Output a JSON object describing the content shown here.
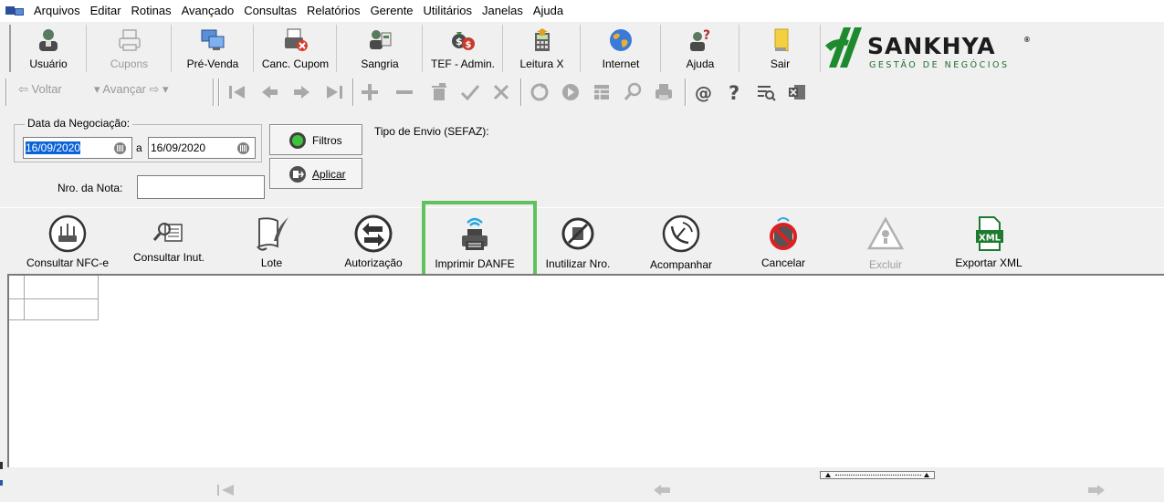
{
  "menubar": {
    "items": [
      "Arquivos",
      "Editar",
      "Rotinas",
      "Avançado",
      "Consultas",
      "Relatórios",
      "Gerente",
      "Utilitários",
      "Janelas",
      "Ajuda"
    ]
  },
  "toolbar": {
    "buttons": [
      {
        "label": "Usuário",
        "icon": "user-icon",
        "enabled": true
      },
      {
        "label": "Cupons",
        "icon": "printer-icon",
        "enabled": false
      },
      {
        "label": "Pré-Venda",
        "icon": "monitors-icon",
        "enabled": true
      },
      {
        "label": "Canc. Cupom",
        "icon": "cancel-receipt-icon",
        "enabled": true
      },
      {
        "label": "Sangria",
        "icon": "cashier-icon",
        "enabled": true
      },
      {
        "label": "TEF - Admin.",
        "icon": "money-bag-icon",
        "enabled": true
      },
      {
        "label": "Leitura X",
        "icon": "calculator-icon",
        "enabled": true
      },
      {
        "label": "Internet",
        "icon": "globe-icon",
        "enabled": true
      },
      {
        "label": "Ajuda",
        "icon": "help-user-icon",
        "enabled": true
      },
      {
        "label": "Sair",
        "icon": "exit-door-icon",
        "enabled": true
      }
    ]
  },
  "navbar": {
    "back_label": "Voltar",
    "forward_label": "Avançar"
  },
  "logo": {
    "name": "SANKHYA",
    "tagline": "GESTÃO DE NEGÓCIOS",
    "reg": "®"
  },
  "filter": {
    "date_label": "Data da Negociação:",
    "date_from": "16/09/2020",
    "date_sep": "a",
    "date_to": "16/09/2020",
    "nota_label": "Nro. da Nota:",
    "nota_value": "",
    "filtros_label": "Filtros",
    "aplicar_label": "Aplicar",
    "tipo_envio_label": "Tipo de Envio (SEFAZ):"
  },
  "actions": {
    "buttons": [
      {
        "label": "Consultar NFC-e",
        "icon": "router-icon",
        "enabled": true
      },
      {
        "label": "Consultar Inut.",
        "icon": "search-document-icon",
        "enabled": true
      },
      {
        "label": "Lote",
        "icon": "scroll-quill-icon",
        "enabled": true
      },
      {
        "label": "Autorização",
        "icon": "arrows-exchange-icon",
        "enabled": true
      },
      {
        "label": "Imprimir DANFE",
        "icon": "wifi-printer-icon",
        "enabled": true
      },
      {
        "label": "Inutilizar Nro.",
        "icon": "trash-forbidden-icon",
        "enabled": true
      },
      {
        "label": "Acompanhar",
        "icon": "satellite-dish-icon",
        "enabled": true
      },
      {
        "label": "Cancelar",
        "icon": "cancel-printer-icon",
        "enabled": true
      },
      {
        "label": "Excluir",
        "icon": "warning-icon",
        "enabled": false
      },
      {
        "label": "Exportar XML",
        "icon": "xml-file-icon",
        "enabled": true
      }
    ]
  },
  "colors": {
    "accent_green": "#5fc25f",
    "selection_blue": "#0a64d8",
    "logo_green": "#1e6e2e"
  }
}
